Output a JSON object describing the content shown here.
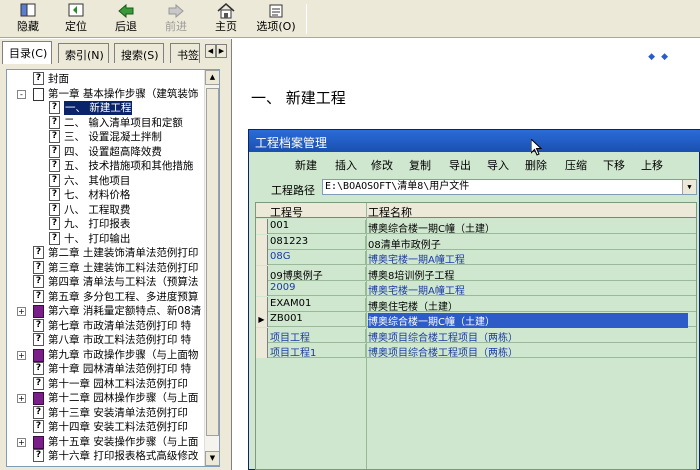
{
  "toolbar": {
    "buttons": [
      {
        "label": "隐藏",
        "icon": "hide-icon"
      },
      {
        "label": "定位",
        "icon": "locate-icon"
      },
      {
        "label": "后退",
        "icon": "back-arrow-icon"
      },
      {
        "label": "前进",
        "icon": "forward-arrow-icon",
        "disabled": true
      },
      {
        "label": "主页",
        "icon": "home-icon"
      },
      {
        "label": "选项(O)",
        "icon": "options-icon"
      }
    ]
  },
  "tabs": [
    "目录(C)",
    "索引(N)",
    "搜索(S)",
    "书签"
  ],
  "tree": [
    {
      "text": "封面",
      "icon": "help-page-icon"
    },
    {
      "text": "第一章  基本操作步骤（建筑装饰",
      "icon": "open-book-icon",
      "expander": "-"
    },
    {
      "text": "一、 新建工程",
      "icon": "help-page-icon",
      "selected": true
    },
    {
      "text": "二、 输入清单项目和定额",
      "icon": "help-page-icon"
    },
    {
      "text": "三、 设置混凝土拌制",
      "icon": "help-page-icon"
    },
    {
      "text": "四、 设置超高降效费",
      "icon": "help-page-icon"
    },
    {
      "text": "五、 技术措施项和其他措施",
      "icon": "help-page-icon"
    },
    {
      "text": "六、 其他项目",
      "icon": "help-page-icon"
    },
    {
      "text": "七、 材料价格",
      "icon": "help-page-icon"
    },
    {
      "text": "八、 工程取费",
      "icon": "help-page-icon"
    },
    {
      "text": "九、 打印报表",
      "icon": "help-page-icon"
    },
    {
      "text": "十、 打印输出",
      "icon": "help-page-icon"
    },
    {
      "text": "第二章  土建装饰清单法范例打印",
      "icon": "help-page-icon"
    },
    {
      "text": "第三章  土建装饰工料法范例打印",
      "icon": "help-page-icon"
    },
    {
      "text": "第四章  清单法与工料法（预算法",
      "icon": "help-page-icon"
    },
    {
      "text": "第五章  多分包工程、多进度预算",
      "icon": "help-page-icon"
    },
    {
      "text": "第六章  消耗量定额特点、新08清",
      "icon": "book-icon",
      "expander": "+"
    },
    {
      "text": "第七章  市政清单法范例打印   特",
      "icon": "help-page-icon"
    },
    {
      "text": "第八章  市政工料法范例打印   特",
      "icon": "help-page-icon"
    },
    {
      "text": "第九章  市政操作步骤（与上面物",
      "icon": "book-icon",
      "expander": "+"
    },
    {
      "text": "第十章  园林清单法范例打印   特",
      "icon": "help-page-icon"
    },
    {
      "text": "第十一章  园林工料法范例打印",
      "icon": "help-page-icon"
    },
    {
      "text": "第十二章  园林操作步骤（与上面",
      "icon": "book-icon",
      "expander": "+"
    },
    {
      "text": "第十三章  安装清单法范例打印",
      "icon": "help-page-icon"
    },
    {
      "text": "第十四章  安装工料法范例打印",
      "icon": "help-page-icon"
    },
    {
      "text": "第十五章  安装操作步骤（与上面",
      "icon": "book-icon",
      "expander": "+"
    },
    {
      "text": "第十六章  打印报表格式高级修改",
      "icon": "help-page-icon"
    }
  ],
  "content": {
    "section_title": "一、  新建工程"
  },
  "dialog": {
    "title": "工程档案管理",
    "buttons": [
      "新建",
      "插入",
      "修改",
      "复制",
      "导出",
      "导入",
      "删除",
      "压缩",
      "下移",
      "上移"
    ],
    "path_label": "工程路径",
    "path_value": "E:\\BOAOSOFT\\清单8\\用户文件",
    "columns": [
      "工程号",
      "工程名称"
    ],
    "rows": [
      {
        "id": "001",
        "name": "博奥综合楼一期C幢（土建）",
        "blue": false
      },
      {
        "id": "081223",
        "name": "08清单市政例子",
        "blue": false
      },
      {
        "id": "08G",
        "name": "博奥宅楼一期A幢工程",
        "blue": true
      },
      {
        "id": "09博奥例子",
        "name": "博奥8培训例子工程",
        "blue": false
      },
      {
        "id": "2009",
        "name": "博奥宅楼一期A幢工程",
        "blue": true
      },
      {
        "id": "EXAM01",
        "name": "博奥住宅楼（土建）",
        "blue": false
      },
      {
        "id": "ZB001",
        "name": "博奥综合楼一期C幢（土建）",
        "blue": false,
        "selected": true
      },
      {
        "id": "项目工程",
        "name": "博奥项目综合楼工程项目（两栋）",
        "blue": true
      },
      {
        "id": "项目工程1",
        "name": "博奥项目综合楼工程项目（两栋）",
        "blue": true
      }
    ]
  }
}
